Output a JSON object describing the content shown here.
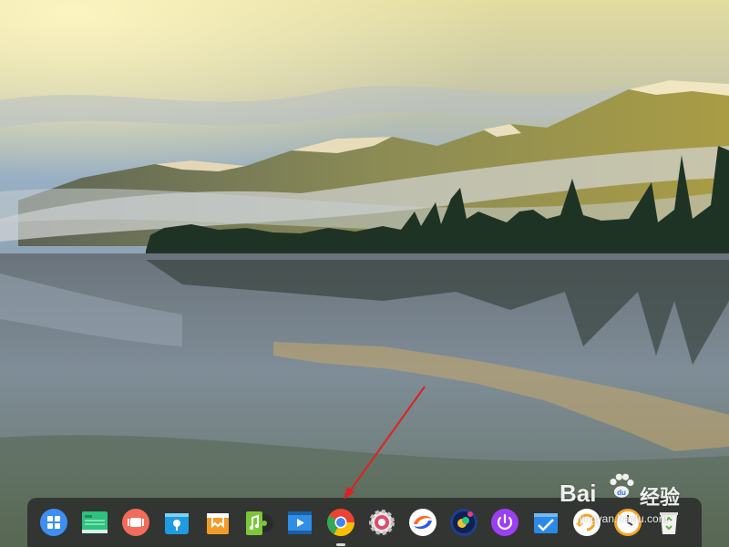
{
  "wallpaper": {
    "name": "lake-mountain-sunrise",
    "colors": {
      "sky_top": "#d9d7a4",
      "sky_mid": "#a9b9c6",
      "mountain": "#8d8f54",
      "water": "#6f7b86"
    }
  },
  "dock": {
    "items": [
      {
        "name": "launcher-icon",
        "label": "Launcher",
        "color": "#3d8ff2",
        "active": false
      },
      {
        "name": "file-manager-icon",
        "label": "File Manager",
        "color": "#2ec27e",
        "active": false
      },
      {
        "name": "screen-recorder-icon",
        "label": "Screen Recorder",
        "color": "#f36b5a",
        "active": false
      },
      {
        "name": "app-store-icon",
        "label": "App Store",
        "color": "#1f9be0",
        "active": false
      },
      {
        "name": "store-bag-icon",
        "label": "Store",
        "color": "#f39b2a",
        "active": false
      },
      {
        "name": "music-icon",
        "label": "Music",
        "color": "#7cc63a",
        "active": false
      },
      {
        "name": "video-player-icon",
        "label": "Movie",
        "color": "#2f8ee6",
        "active": false
      },
      {
        "name": "chrome-browser-icon",
        "label": "Google Chrome",
        "color": "#4285f4",
        "active": true
      },
      {
        "name": "settings-gear-icon",
        "label": "Control Center",
        "color": "#e04a6a",
        "active": false
      },
      {
        "name": "browser-swirl-icon",
        "label": "Browser",
        "color": "#ff6a2b",
        "active": false
      },
      {
        "name": "image-viewer-icon",
        "label": "Image Viewer",
        "color": "#1f3f8a",
        "active": false
      },
      {
        "name": "power-icon",
        "label": "Shutdown",
        "color": "#9b3ff2",
        "active": false
      },
      {
        "name": "system-monitor-icon",
        "label": "System Monitor",
        "color": "#2b8ae8",
        "active": false
      },
      {
        "name": "rotate-icon",
        "label": "Rotate",
        "color": "#f3a72a",
        "active": false
      },
      {
        "name": "clock-icon",
        "label": "Clock",
        "color": "#f3a72a",
        "active": false
      },
      {
        "name": "trash-icon",
        "label": "Trash",
        "color": "#8fb97a",
        "active": false
      }
    ]
  },
  "watermark": {
    "brand_prefix": "Bai",
    "brand_suffix": "经验",
    "url_text": "jingyan.baidu.com"
  }
}
